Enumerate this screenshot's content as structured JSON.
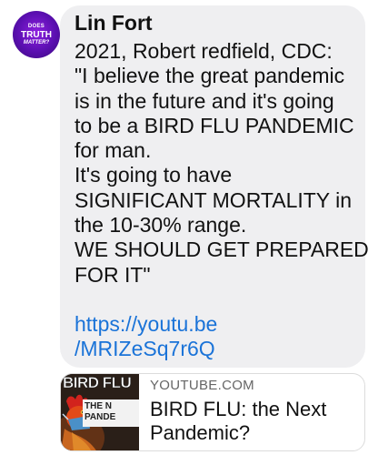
{
  "avatar": {
    "line1": "DOES",
    "line2": "TRUTH",
    "line3": "MATTER?",
    "color": "#6a16c4"
  },
  "post": {
    "author": "Lin Fort",
    "body_lines": [
      "2021, Robert redfield, CDC:",
      "\"I believe the great pandemic",
      "is in the future and it's going",
      "to be a BIRD FLU PANDEMIC",
      "for man.",
      "It's going to have",
      "SIGNIFICANT MORTALITY in",
      "the 10-30% range.",
      "WE SHOULD GET PREPARED",
      "FOR IT\""
    ],
    "link_lines": [
      "https://youtu.be",
      "/MRIZeSq7r6Q"
    ],
    "link_color": "#1a73d8"
  },
  "link_preview": {
    "thumbnail_title": "BIRD FLU",
    "thumbnail_sub_line1": "THE N",
    "thumbnail_sub_line2": "PANDE",
    "domain": "YOUTUBE.COM",
    "title_lines": [
      "BIRD FLU: the Next",
      "Pandemic?"
    ]
  }
}
